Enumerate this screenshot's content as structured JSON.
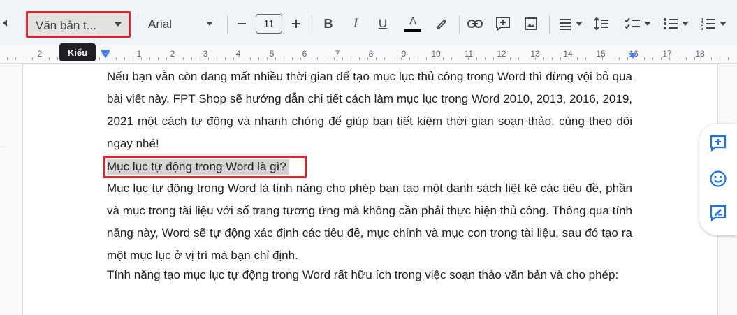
{
  "toolbar": {
    "style_select": "Văn bản t...",
    "font_select": "Arial",
    "font_size": "11",
    "tooltip": "Kiểu",
    "icons": [
      "menu-caret-icon",
      "decrease-font-icon",
      "increase-font-icon",
      "bold-icon",
      "italic-icon",
      "underline-icon",
      "text-color-icon",
      "highlight-icon",
      "link-icon",
      "add-comment-icon",
      "image-icon",
      "align-icon",
      "line-spacing-icon",
      "checklist-icon",
      "bullet-list-icon",
      "numbered-list-icon"
    ],
    "colors": {
      "highlight_border": "#d9232d",
      "toolbar_bg": "#f0f4f9"
    }
  },
  "ruler": {
    "labels": [
      "2",
      "1",
      "1",
      "2",
      "3",
      "4",
      "5",
      "6",
      "7",
      "8",
      "9",
      "10",
      "11",
      "12",
      "13",
      "14",
      "15",
      "16",
      "17",
      "18"
    ]
  },
  "document": {
    "para1": "Nếu bạn vẫn còn đang mất nhiều thời gian để tạo mục lục thủ công trong Word thì đừng vội bỏ qua bài viết này. FPT Shop sẽ hướng dẫn chi tiết cách làm mục lục trong Word 2010, 2013, 2016, 2019, 2021 một cách tự động và nhanh chóng để giúp bạn tiết kiệm thời gian soạn thảo, cùng theo dõi ngay nhé!",
    "heading": "Mục lục tự động trong Word là gì?",
    "para2": "Mục lục tự động trong Word là tính năng cho phép bạn tạo một danh sách liệt kê các tiêu đề, phần và mục trong tài liệu với số trang tương ứng mà không cần phải thực hiện thủ công. Thông qua tính năng này, Word sẽ tự động xác định các tiêu đề, mục chính và mục con trong tài liệu, sau đó tạo ra một mục lục ở vị trí mà bạn chỉ định.",
    "para3": "Tính năng tạo mục lục tự động trong Word rất hữu ích trong việc soạn thảo văn bản và cho phép:"
  },
  "side_panel": {
    "icons": [
      "add-comment-icon",
      "emoji-reaction-icon",
      "suggest-edits-icon"
    ]
  }
}
